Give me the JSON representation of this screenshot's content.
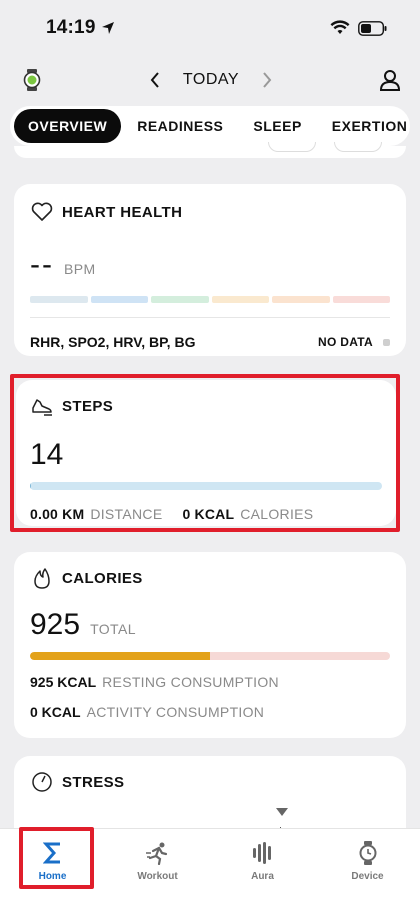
{
  "status_bar": {
    "time": "14:19"
  },
  "header": {
    "date_label": "TODAY"
  },
  "tabs": [
    {
      "label": "OVERVIEW",
      "active": true
    },
    {
      "label": "READINESS",
      "active": false
    },
    {
      "label": "SLEEP",
      "active": false
    },
    {
      "label": "EXERTION",
      "active": false
    }
  ],
  "heart_health": {
    "title": "HEART HEALTH",
    "value": "--",
    "unit": "BPM",
    "metrics": "RHR, SPO2, HRV, BP, BG",
    "status": "NO DATA"
  },
  "steps": {
    "title": "STEPS",
    "value": "14",
    "progress": 0.003,
    "distance_value": "0.00 KM",
    "distance_label": "DISTANCE",
    "calories_value": "0 KCAL",
    "calories_label": "CALORIES"
  },
  "calories": {
    "title": "CALORIES",
    "value": "925",
    "unit": "TOTAL",
    "progress": 0.5,
    "resting_value": "925 KCAL",
    "resting_label": "RESTING CONSUMPTION",
    "activity_value": "0 KCAL",
    "activity_label": "ACTIVITY CONSUMPTION"
  },
  "stress": {
    "title": "STRESS"
  },
  "bottom_nav": [
    {
      "label": "Home",
      "icon": "sigma-icon",
      "active": true
    },
    {
      "label": "Workout",
      "icon": "running-icon",
      "active": false
    },
    {
      "label": "Aura",
      "icon": "aura-icon",
      "active": false
    },
    {
      "label": "Device",
      "icon": "watch-icon",
      "active": false
    }
  ],
  "colors": {
    "accent_blue": "#1a6fc8",
    "highlight_red": "#e01e2b",
    "steps_bar": "#cfe6f3",
    "calories_resting": "#e3a21a",
    "calories_remaining": "#f6d9d6"
  }
}
